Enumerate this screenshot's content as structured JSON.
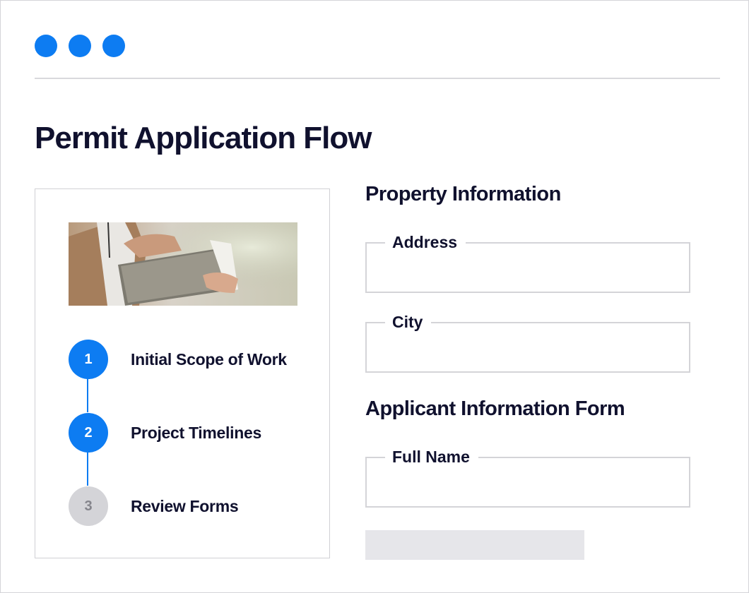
{
  "colors": {
    "accent": "#0d7cf2",
    "inactive": "#d4d4d8",
    "text": "#10112e"
  },
  "window": {
    "controls": [
      "dot",
      "dot",
      "dot"
    ]
  },
  "page": {
    "title": "Permit Application Flow"
  },
  "steps": [
    {
      "number": "1",
      "label": "Initial Scope of Work",
      "state": "complete"
    },
    {
      "number": "2",
      "label": "Project Timelines",
      "state": "complete"
    },
    {
      "number": "3",
      "label": "Review Forms",
      "state": "inactive"
    }
  ],
  "property_section": {
    "title": "Property Information",
    "fields": [
      {
        "label": "Address",
        "value": ""
      },
      {
        "label": "City",
        "value": ""
      }
    ]
  },
  "applicant_section": {
    "title": "Applicant Information Form",
    "fields": [
      {
        "label": "Full Name",
        "value": ""
      }
    ]
  }
}
